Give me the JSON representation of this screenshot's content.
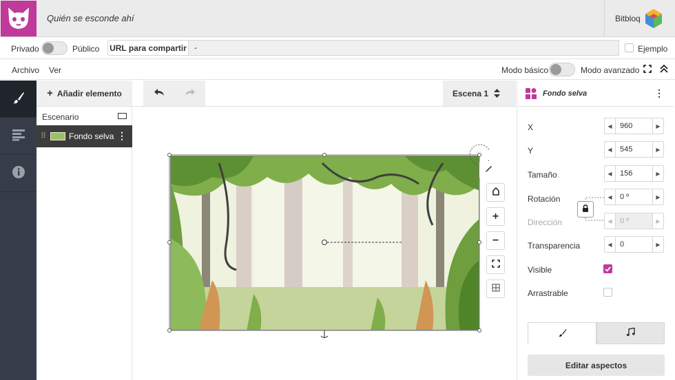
{
  "header": {
    "project_title": "Quién se esconde ahí",
    "brand": "Bitbloq",
    "logo_icon": "cat-face-icon",
    "brand_icon": "cube-icon",
    "accent": "#c0399b"
  },
  "share": {
    "private_label": "Privado",
    "public_label": "Público",
    "url_button": "URL para compartir",
    "url_value": "-",
    "example_label": "Ejemplo"
  },
  "menu": {
    "file": "Archivo",
    "view": "Ver",
    "basic_mode": "Modo básico",
    "advanced_mode": "Modo avanzado"
  },
  "elements": {
    "add_label": "Añadir elemento",
    "scene_label": "Escenario",
    "item_label": "Fondo selva"
  },
  "toolbar": {
    "scene_select": "Escena 1"
  },
  "properties": {
    "title": "Fondo selva",
    "x_label": "X",
    "x_value": "960",
    "y_label": "Y",
    "y_value": "545",
    "size_label": "Tamaño",
    "size_value": "156",
    "rotation_label": "Rotación",
    "rotation_value": "0 º",
    "direction_label": "Dirección",
    "direction_value": "0 º",
    "transparency_label": "Transparencia",
    "transparency_value": "0",
    "visible_label": "Visible",
    "visible_checked": true,
    "draggable_label": "Arrastrable",
    "draggable_checked": false,
    "edit_button": "Editar aspectos"
  }
}
